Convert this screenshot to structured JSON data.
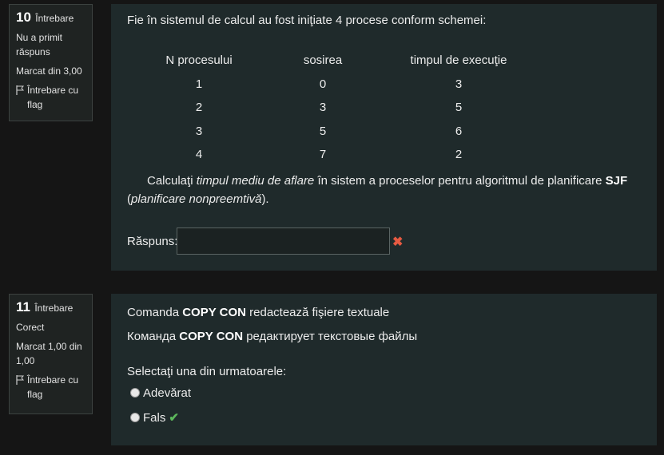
{
  "q10": {
    "number": "10",
    "label": "Întrebare",
    "status": "Nu a primit răspuns",
    "mark": "Marcat din 3,00",
    "flag_label": "Întrebare cu flag",
    "text_intro": "Fie în sistemul de calcul au fost iniţiate  4 procese conform schemei:",
    "table": {
      "headers": [
        "N procesului",
        "sosirea",
        "timpul de execuţie"
      ],
      "rows": [
        [
          "1",
          "0",
          "3"
        ],
        [
          "2",
          "3",
          "5"
        ],
        [
          "3",
          "5",
          "6"
        ],
        [
          "4",
          "7",
          "2"
        ]
      ]
    },
    "task_part1": "Calculaţi ",
    "task_em1": "timpul mediu de aflare",
    "task_part2": " în sistem a proceselor pentru algoritmul de planificare ",
    "task_bold": "SJF",
    "task_part3": " (",
    "task_em2": "planificare nonpreemtivă",
    "task_part4": ").",
    "answer_label": "Răspuns:",
    "answer_value": "",
    "incorrect_mark": "✖"
  },
  "q11": {
    "number": "11",
    "label": "Întrebare",
    "status": "Corect",
    "mark": "Marcat 1,00 din 1,00",
    "flag_label": "Întrebare cu flag",
    "line1_pre": "Comanda ",
    "line1_bold": "COPY CON",
    "line1_post": " redactează fişiere textuale",
    "line2_pre": "Команда ",
    "line2_bold": "COPY CON",
    "line2_post": "  редактирует текстовые файлы",
    "prompt": "Selectaţi una din urmatoarele:",
    "options": [
      "Adevărat",
      "Fals"
    ],
    "correct_mark": "✔"
  },
  "colors": {
    "incorrect": "#e55a42",
    "correct": "#5cb85c",
    "panel": "#1f2a2b"
  }
}
